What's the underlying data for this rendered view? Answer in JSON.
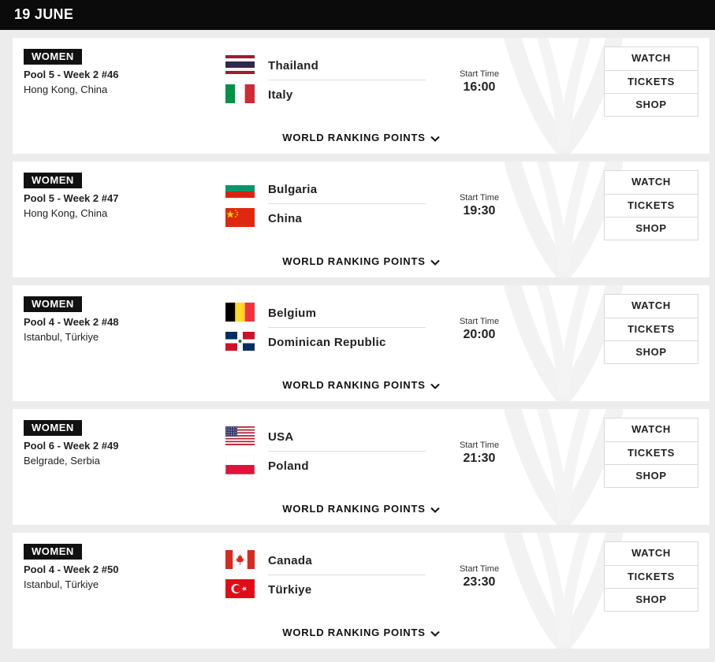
{
  "date_header": "19 JUNE",
  "labels": {
    "start_time": "Start Time",
    "watch": "WATCH",
    "tickets": "TICKETS",
    "shop": "SHOP",
    "ranking_points": "WORLD RANKING POINTS"
  },
  "matches": [
    {
      "gender": "WOMEN",
      "pool": "Pool 5 - Week 2 #46",
      "venue": "Hong Kong, China",
      "team1": "Thailand",
      "team1_flag": "thailand-flag-icon",
      "team2": "Italy",
      "team2_flag": "italy-flag-icon",
      "time": "16:00"
    },
    {
      "gender": "WOMEN",
      "pool": "Pool 5 - Week 2 #47",
      "venue": "Hong Kong, China",
      "team1": "Bulgaria",
      "team1_flag": "bulgaria-flag-icon",
      "team2": "China",
      "team2_flag": "china-flag-icon",
      "time": "19:30"
    },
    {
      "gender": "WOMEN",
      "pool": "Pool 4 - Week 2 #48",
      "venue": "Istanbul, Türkiye",
      "team1": "Belgium",
      "team1_flag": "belgium-flag-icon",
      "team2": "Dominican Republic",
      "team2_flag": "dominican-republic-flag-icon",
      "time": "20:00"
    },
    {
      "gender": "WOMEN",
      "pool": "Pool 6 - Week 2 #49",
      "venue": "Belgrade, Serbia",
      "team1": "USA",
      "team1_flag": "usa-flag-icon",
      "team2": "Poland",
      "team2_flag": "poland-flag-icon",
      "time": "21:30"
    },
    {
      "gender": "WOMEN",
      "pool": "Pool 4 - Week 2 #50",
      "venue": "Istanbul, Türkiye",
      "team1": "Canada",
      "team1_flag": "canada-flag-icon",
      "team2": "Türkiye",
      "team2_flag": "turkiye-flag-icon",
      "time": "23:30"
    }
  ]
}
